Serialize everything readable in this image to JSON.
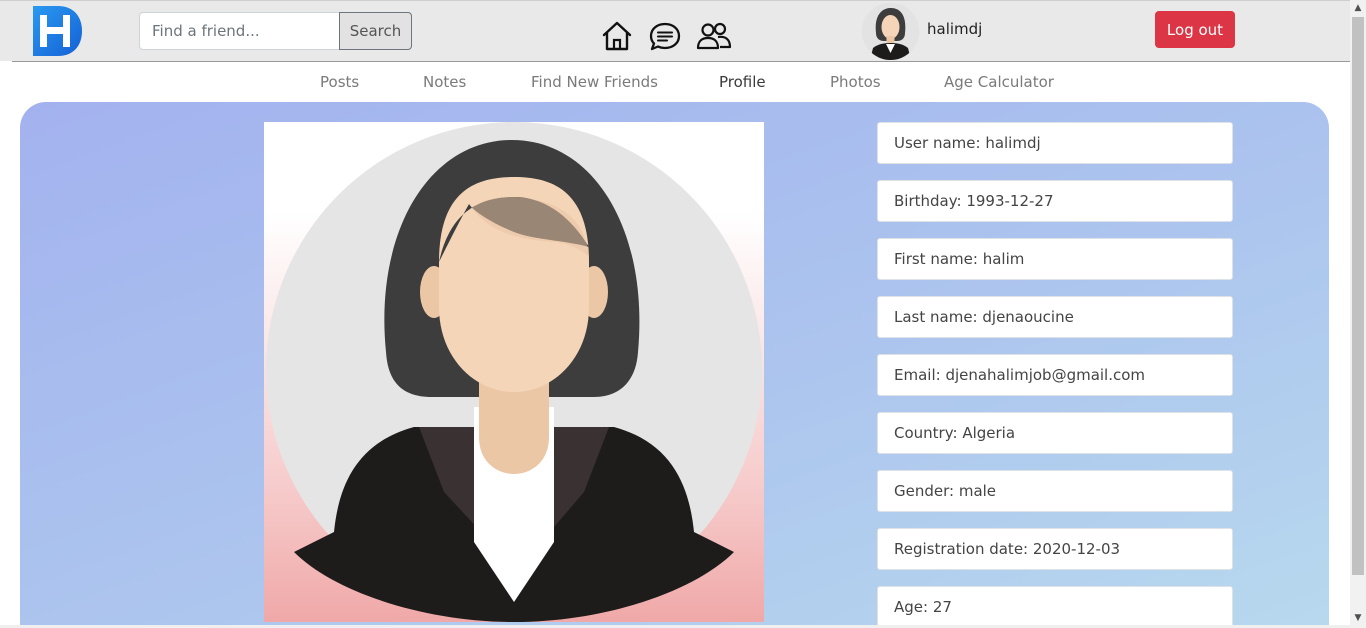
{
  "header": {
    "logo_letter": "H",
    "search": {
      "placeholder": "Find a friend...",
      "value": "",
      "button_label": "Search"
    },
    "icons": [
      "home-icon",
      "chat-icon",
      "friends-icon"
    ],
    "username": "halimdj",
    "logout_label": "Log out"
  },
  "nav": {
    "items": [
      {
        "label": "Posts"
      },
      {
        "label": "Notes"
      },
      {
        "label": "Find New Friends"
      },
      {
        "label": "Profile",
        "active": true
      },
      {
        "label": "Photos"
      },
      {
        "label": "Age Calculator"
      }
    ]
  },
  "profile": {
    "fields": [
      "User name: halimdj",
      "Birthday: 1993-12-27",
      "First name: halim",
      "Last name: djenaoucine",
      "Email: djenahalimjob@gmail.com",
      "Country: Algeria",
      "Gender: male",
      "Registration date: 2020-12-03",
      "Age: 27"
    ]
  },
  "colors": {
    "logout": "#dc3545",
    "logo_blue": "#1f7be6",
    "panel_gradient_start": "#a3b2ef",
    "panel_gradient_end": "#b8d9ee"
  }
}
